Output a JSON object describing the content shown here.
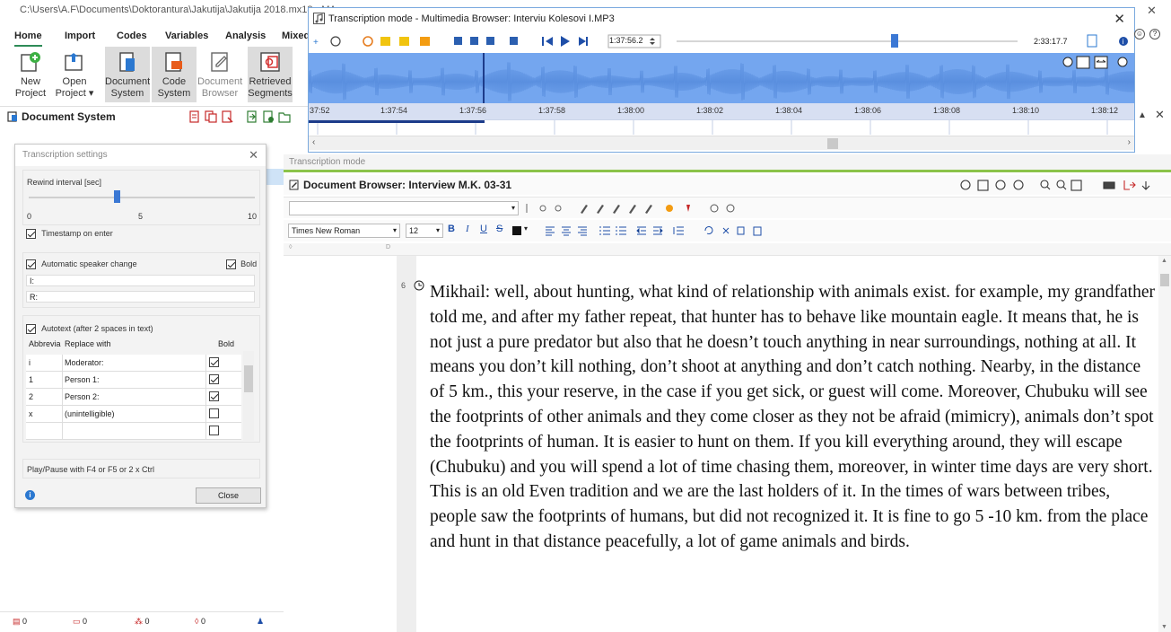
{
  "app": {
    "title": "C:\\Users\\A.F\\Documents\\Doktorantura\\Jakutija\\Jakutija 2018.mx18 - MA",
    "colors": {
      "accent": "#2e8b57",
      "wave": "#74a6ef",
      "green_bar": "#8bc34a"
    }
  },
  "ribbon": {
    "tabs": [
      "Home",
      "Import",
      "Codes",
      "Variables",
      "Analysis",
      "Mixed"
    ],
    "tools": [
      {
        "label1": "New",
        "label2": "Project",
        "icon": "new-project-icon"
      },
      {
        "label1": "Open",
        "label2": "Project ▾",
        "icon": "open-project-icon"
      },
      {
        "label1": "Document",
        "label2": "System",
        "icon": "document-system-icon"
      },
      {
        "label1": "Code",
        "label2": "System",
        "icon": "code-system-icon"
      },
      {
        "label1": "Document",
        "label2": "Browser",
        "icon": "document-browser-icon"
      },
      {
        "label1": "Retrieved",
        "label2": "Segments",
        "icon": "retrieved-segments-icon"
      }
    ]
  },
  "document_system": {
    "title": "Document System"
  },
  "transcription_settings": {
    "title": "Transcription settings",
    "rewind_label": "Rewind interval [sec]",
    "rewind_value": 4,
    "scale": [
      "0",
      "5",
      "10"
    ],
    "timestamp_on_enter": "Timestamp on enter",
    "auto_speaker": "Automatic speaker change",
    "bold": "Bold",
    "speaker1": "I:",
    "speaker2": "R:",
    "autotext": "Autotext (after 2 spaces in text)",
    "col_abbr": "Abbrevia",
    "col_replace": "Replace with",
    "col_bold": "Bold",
    "rows": [
      {
        "abbr": "i",
        "replace": "Moderator:",
        "bold": true
      },
      {
        "abbr": "1",
        "replace": "Person 1:",
        "bold": true
      },
      {
        "abbr": "2",
        "replace": "Person 2:",
        "bold": true
      },
      {
        "abbr": "x",
        "replace": "(unintelligible)",
        "bold": false
      },
      {
        "abbr": "",
        "replace": "",
        "bold": false
      }
    ],
    "play_hint": "Play/Pause with F4 or F5 or 2 x Ctrl",
    "close": "Close"
  },
  "multimedia": {
    "title": "Transcription mode - Multimedia Browser:  Interviu Kolesovi I.MP3",
    "position": "1:37:56.2",
    "duration": "2:33:17.7",
    "ticks": [
      "37:52",
      "1:37:54",
      "1:37:56",
      "1:37:58",
      "1:38:00",
      "1:38:02",
      "1:38:04",
      "1:38:06",
      "1:38:08",
      "1:38:10",
      "1:38:12"
    ]
  },
  "transcription_mode_label": "Transcription mode",
  "document_browser": {
    "title": "Document Browser: Interview M.K.  03-31",
    "font": "Times New Roman",
    "font_size": "12",
    "paragraph_number": "6",
    "text": "Mikhail: well, about hunting, what kind of relationship with animals exist. for example, my grandfather told me, and after my father repeat, that hunter has to behave like mountain eagle. It means that, he is not just a pure predator but also that he doesn’t touch anything in near surroundings, nothing at all. It means you don’t kill nothing, don’t shoot at anything and don’t catch nothing. Nearby, in the distance of 5 km., this your reserve, in the case if you get sick, or guest will come. Moreover, Chubuku will see the footprints of other animals and they come closer as they not be afraid (mimicry), animals don’t spot the footprints of human. It is easier to hunt on them. If you kill everything around, they will escape (Chubuku) and you will spend a lot of time chasing them, moreover, in winter time days are very short. This is an old Even tradition and we are the last holders of it. In the times of wars between tribes, people saw the footprints of humans, but did not recognized it. It is fine to go 5 -10 km. from the place and hunt in that distance peacefully, a lot of game animals and birds."
  },
  "status": [
    "0",
    "0",
    "0",
    "0"
  ]
}
